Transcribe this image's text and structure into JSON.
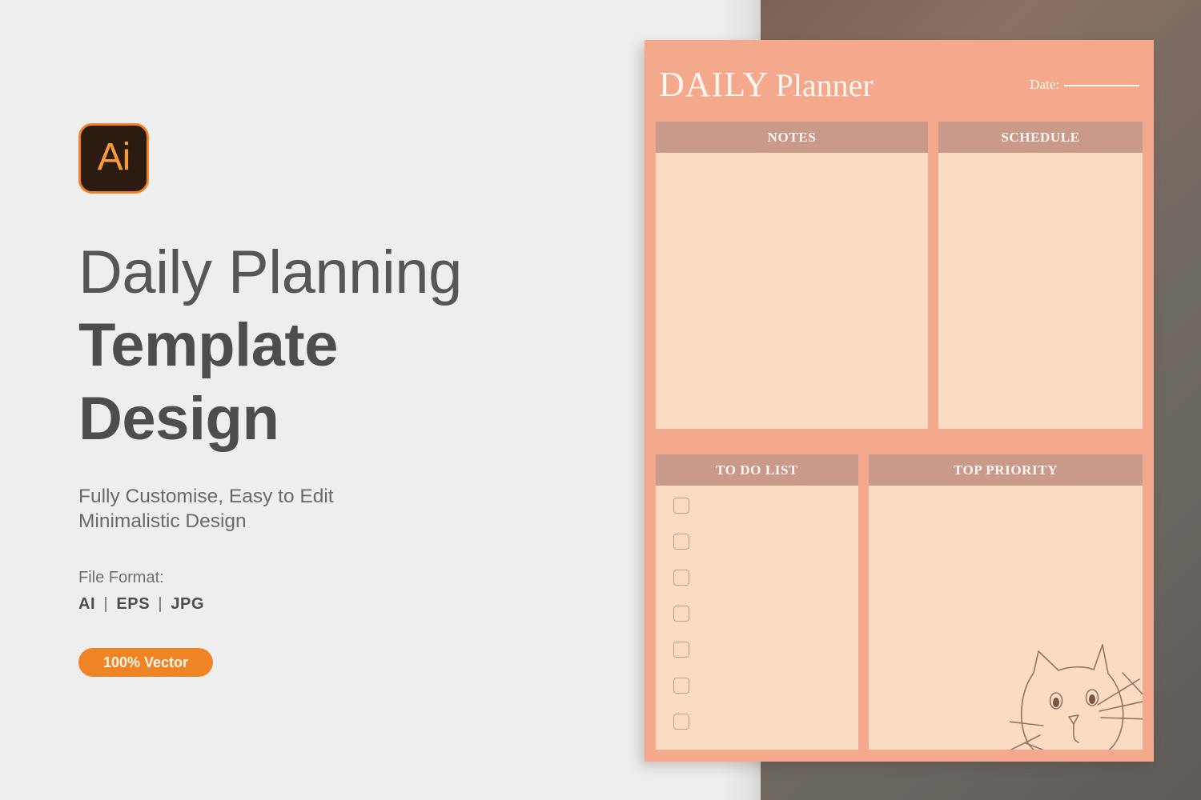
{
  "background": {
    "left_panel_color": "#efeeee",
    "right_panel_color": "#73655c"
  },
  "left": {
    "logo": {
      "icon": "adobe-illustrator-icon",
      "text": "Ai",
      "bg_color": "#2b1b11",
      "accent_color": "#f18121"
    },
    "headline_line1": "Daily Planning",
    "headline_line2": "Template",
    "headline_line3": "Design",
    "subtitle_line1": "Fully Customise, Easy to Edit",
    "subtitle_line2": "Minimalistic Design",
    "file_format_label": "File Format:",
    "file_formats": [
      "AI",
      "EPS",
      "JPG"
    ],
    "file_format_separator": "|",
    "badge_label": "100% Vector",
    "badge_color": "#ee8424"
  },
  "planner": {
    "card_color": "#f4a98c",
    "header_color": "#c99a89",
    "body_color": "#fadcc3",
    "title_bold": "DAILY",
    "title_light": "Planner",
    "date_label": "Date:",
    "sections": [
      {
        "key": "notes",
        "title": "NOTES"
      },
      {
        "key": "schedule",
        "title": "SCHEDULE"
      },
      {
        "key": "todo",
        "title": "TO DO LIST"
      },
      {
        "key": "priority",
        "title": "TOP PRIORITY"
      }
    ],
    "todo_checkbox_count": 7,
    "decoration_icon": "cat-face-icon"
  }
}
